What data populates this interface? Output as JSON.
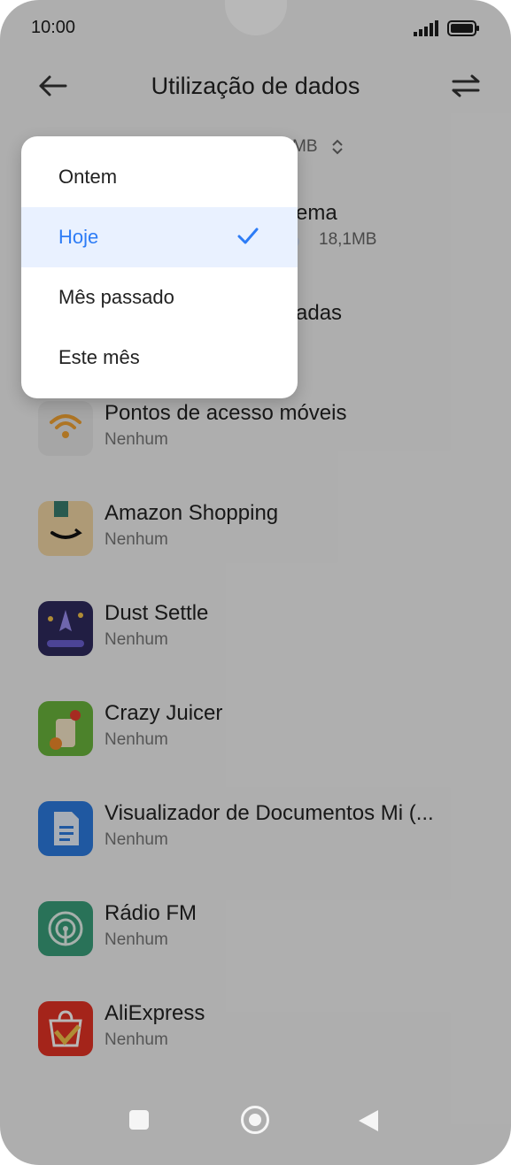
{
  "status_bar": {
    "time": "10:00"
  },
  "header": {
    "title": "Utilização de dados"
  },
  "summary": {
    "value": "MB"
  },
  "menu": {
    "items": [
      {
        "label": "Ontem",
        "selected": false
      },
      {
        "label": "Hoje",
        "selected": true
      },
      {
        "label": "Mês passado",
        "selected": false
      },
      {
        "label": "Este mês",
        "selected": false
      }
    ]
  },
  "apps": [
    {
      "name": "ema",
      "usage_text": "18,1MB",
      "usage_fraction": 0.9
    },
    {
      "name": "adas",
      "sub": ""
    },
    {
      "name": "Pontos de acesso móveis",
      "sub": "Nenhum"
    },
    {
      "name": "Amazon Shopping",
      "sub": "Nenhum"
    },
    {
      "name": "Dust Settle",
      "sub": "Nenhum"
    },
    {
      "name": "Crazy Juicer",
      "sub": "Nenhum"
    },
    {
      "name": "Visualizador de Documentos Mi (...",
      "sub": "Nenhum"
    },
    {
      "name": "Rádio FM",
      "sub": "Nenhum"
    },
    {
      "name": "AliExpress",
      "sub": "Nenhum"
    }
  ],
  "colors": {
    "accent": "#2d7cf6",
    "menu_selected_bg": "#e9f1ff"
  }
}
